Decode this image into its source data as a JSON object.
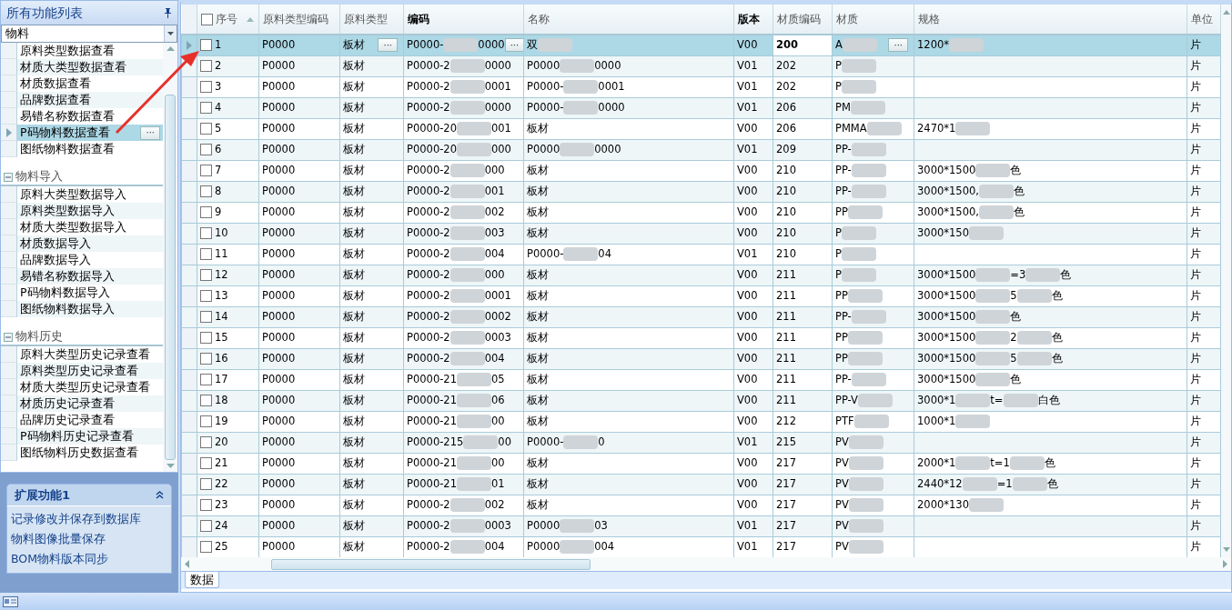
{
  "sidebar": {
    "title": "所有功能列表",
    "filter": {
      "value": "物料"
    },
    "ellipsis": "···",
    "groups": [
      {
        "items": [
          {
            "label": "原料类型数据查看",
            "selected": false
          },
          {
            "label": "材质大类型数据查看",
            "selected": false
          },
          {
            "label": "材质数据查看",
            "selected": false
          },
          {
            "label": "品牌数据查看",
            "selected": false
          },
          {
            "label": "易错名称数据查看",
            "selected": false
          },
          {
            "label": "P码物料数据查看",
            "selected": true
          },
          {
            "label": "图纸物料数据查看",
            "selected": false
          }
        ]
      },
      {
        "label": "物料导入",
        "expanded": true,
        "items": [
          {
            "label": "原料大类型数据导入",
            "selected": false
          },
          {
            "label": "原料类型数据导入",
            "selected": false
          },
          {
            "label": "材质大类型数据导入",
            "selected": false
          },
          {
            "label": "材质数据导入",
            "selected": false
          },
          {
            "label": "品牌数据导入",
            "selected": false
          },
          {
            "label": "易错名称数据导入",
            "selected": false
          },
          {
            "label": "P码物料数据导入",
            "selected": false
          },
          {
            "label": "图纸物料数据导入",
            "selected": false
          }
        ]
      },
      {
        "label": "物料历史",
        "expanded": true,
        "items": [
          {
            "label": "原料大类型历史记录查看",
            "selected": false
          },
          {
            "label": "原料类型历史记录查看",
            "selected": false
          },
          {
            "label": "材质大类型历史记录查看",
            "selected": false
          },
          {
            "label": "材质历史记录查看",
            "selected": false
          },
          {
            "label": "品牌历史记录查看",
            "selected": false
          },
          {
            "label": "P码物料历史记录查看",
            "selected": false
          },
          {
            "label": "图纸物料历史数据查看",
            "selected": false
          }
        ]
      }
    ]
  },
  "extension_panel": {
    "title": "扩展功能1",
    "expanded": true,
    "links": [
      "记录修改并保存到数据库",
      "物料图像批量保存",
      "BOM物料版本同步"
    ]
  },
  "table": {
    "select_all": {
      "checked": false
    },
    "columns": [
      {
        "label": "序号",
        "bold": false,
        "sorted": true
      },
      {
        "label": "原料类型编码",
        "bold": false,
        "sorted": false
      },
      {
        "label": "原料类型",
        "bold": false,
        "sorted": false
      },
      {
        "label": "编码",
        "bold": true,
        "sorted": false
      },
      {
        "label": "名称",
        "bold": false,
        "sorted": false
      },
      {
        "label": "版本",
        "bold": true,
        "sorted": false
      },
      {
        "label": "材质编码",
        "bold": false,
        "sorted": false
      },
      {
        "label": "材质",
        "bold": false,
        "sorted": false
      },
      {
        "label": "规格",
        "bold": false,
        "sorted": false
      },
      {
        "label": "单位",
        "bold": false,
        "sorted": false
      }
    ],
    "rows": [
      {
        "selected": true,
        "checked": false,
        "cells": [
          "1",
          "P0000",
          {
            "text": "板材",
            "button": "···"
          },
          {
            "parts": [
              {
                "kind": "text",
                "text": "P0000-"
              },
              {
                "kind": "blur"
              },
              {
                "kind": "text",
                "text": "0000"
              }
            ],
            "button": "···"
          },
          [
            {
              "kind": "text",
              "text": "双"
            },
            {
              "kind": "blur"
            }
          ],
          "V00",
          "200",
          {
            "parts": [
              {
                "kind": "text",
                "text": "A"
              },
              {
                "kind": "blur"
              }
            ],
            "button": "···"
          },
          [
            {
              "kind": "text",
              "text": "1200*"
            },
            {
              "kind": "blur"
            }
          ],
          "片"
        ]
      },
      {
        "selected": false,
        "checked": false,
        "cells": [
          "2",
          "P0000",
          "板材",
          [
            {
              "kind": "text",
              "text": "P0000-2"
            },
            {
              "kind": "blur"
            },
            {
              "kind": "text",
              "text": "0000"
            }
          ],
          [
            {
              "kind": "text",
              "text": "P0000"
            },
            {
              "kind": "blur"
            },
            {
              "kind": "text",
              "text": "0000"
            }
          ],
          "V01",
          "202",
          [
            {
              "kind": "text",
              "text": "P"
            },
            {
              "kind": "blur"
            }
          ],
          null,
          "片"
        ]
      },
      {
        "selected": false,
        "checked": false,
        "cells": [
          "3",
          "P0000",
          "板材",
          [
            {
              "kind": "text",
              "text": "P0000-2"
            },
            {
              "kind": "blur"
            },
            {
              "kind": "text",
              "text": "0001"
            }
          ],
          [
            {
              "kind": "text",
              "text": "P0000-"
            },
            {
              "kind": "blur"
            },
            {
              "kind": "text",
              "text": "0001"
            }
          ],
          "V01",
          "202",
          [
            {
              "kind": "text",
              "text": "P"
            },
            {
              "kind": "blur"
            }
          ],
          null,
          "片"
        ]
      },
      {
        "selected": false,
        "checked": false,
        "cells": [
          "4",
          "P0000",
          "板材",
          [
            {
              "kind": "text",
              "text": "P0000-2"
            },
            {
              "kind": "blur"
            },
            {
              "kind": "text",
              "text": "0000"
            }
          ],
          [
            {
              "kind": "text",
              "text": "P0000-"
            },
            {
              "kind": "blur"
            },
            {
              "kind": "text",
              "text": "0000"
            }
          ],
          "V01",
          "206",
          [
            {
              "kind": "text",
              "text": "PM"
            },
            {
              "kind": "blur"
            }
          ],
          null,
          "片"
        ]
      },
      {
        "selected": false,
        "checked": false,
        "cells": [
          "5",
          "P0000",
          "板材",
          [
            {
              "kind": "text",
              "text": "P0000-20"
            },
            {
              "kind": "blur"
            },
            {
              "kind": "text",
              "text": "001"
            }
          ],
          "板材",
          "V00",
          "206",
          [
            {
              "kind": "text",
              "text": "PMMA"
            },
            {
              "kind": "blur"
            }
          ],
          [
            {
              "kind": "text",
              "text": "2470*1"
            },
            {
              "kind": "blur"
            }
          ],
          "片"
        ]
      },
      {
        "selected": false,
        "checked": false,
        "cells": [
          "6",
          "P0000",
          "板材",
          [
            {
              "kind": "text",
              "text": "P0000-20"
            },
            {
              "kind": "blur"
            },
            {
              "kind": "text",
              "text": "000"
            }
          ],
          [
            {
              "kind": "text",
              "text": "P0000"
            },
            {
              "kind": "blur"
            },
            {
              "kind": "text",
              "text": "0000"
            }
          ],
          "V01",
          "209",
          [
            {
              "kind": "text",
              "text": "PP-"
            },
            {
              "kind": "blur"
            }
          ],
          null,
          "片"
        ]
      },
      {
        "selected": false,
        "checked": false,
        "cells": [
          "7",
          "P0000",
          "板材",
          [
            {
              "kind": "text",
              "text": "P0000-2"
            },
            {
              "kind": "blur"
            },
            {
              "kind": "text",
              "text": "000"
            }
          ],
          "板材",
          "V00",
          "210",
          [
            {
              "kind": "text",
              "text": "PP-"
            },
            {
              "kind": "blur"
            }
          ],
          [
            {
              "kind": "text",
              "text": "3000*1500"
            },
            {
              "kind": "blur"
            },
            {
              "kind": "text",
              "text": "色"
            }
          ],
          "片"
        ]
      },
      {
        "selected": false,
        "checked": false,
        "cells": [
          "8",
          "P0000",
          "板材",
          [
            {
              "kind": "text",
              "text": "P0000-2"
            },
            {
              "kind": "blur"
            },
            {
              "kind": "text",
              "text": "001"
            }
          ],
          "板材",
          "V00",
          "210",
          [
            {
              "kind": "text",
              "text": "PP-"
            },
            {
              "kind": "blur"
            }
          ],
          [
            {
              "kind": "text",
              "text": "3000*1500,"
            },
            {
              "kind": "blur"
            },
            {
              "kind": "text",
              "text": "色"
            }
          ],
          "片"
        ]
      },
      {
        "selected": false,
        "checked": false,
        "cells": [
          "9",
          "P0000",
          "板材",
          [
            {
              "kind": "text",
              "text": "P0000-2"
            },
            {
              "kind": "blur"
            },
            {
              "kind": "text",
              "text": "002"
            }
          ],
          "板材",
          "V00",
          "210",
          [
            {
              "kind": "text",
              "text": "PP"
            },
            {
              "kind": "blur"
            }
          ],
          [
            {
              "kind": "text",
              "text": "3000*1500,"
            },
            {
              "kind": "blur"
            },
            {
              "kind": "text",
              "text": "色"
            }
          ],
          "片"
        ]
      },
      {
        "selected": false,
        "checked": false,
        "cells": [
          "10",
          "P0000",
          "板材",
          [
            {
              "kind": "text",
              "text": "P0000-2"
            },
            {
              "kind": "blur"
            },
            {
              "kind": "text",
              "text": "003"
            }
          ],
          "板材",
          "V00",
          "210",
          [
            {
              "kind": "text",
              "text": "P"
            },
            {
              "kind": "blur"
            }
          ],
          [
            {
              "kind": "text",
              "text": "3000*150"
            },
            {
              "kind": "blur"
            }
          ],
          "片"
        ]
      },
      {
        "selected": false,
        "checked": false,
        "cells": [
          "11",
          "P0000",
          "板材",
          [
            {
              "kind": "text",
              "text": "P0000-2"
            },
            {
              "kind": "blur"
            },
            {
              "kind": "text",
              "text": "004"
            }
          ],
          [
            {
              "kind": "text",
              "text": "P0000-"
            },
            {
              "kind": "blur"
            },
            {
              "kind": "text",
              "text": "04"
            }
          ],
          "V01",
          "210",
          [
            {
              "kind": "text",
              "text": "P"
            },
            {
              "kind": "blur"
            }
          ],
          null,
          "片"
        ]
      },
      {
        "selected": false,
        "checked": false,
        "cells": [
          "12",
          "P0000",
          "板材",
          [
            {
              "kind": "text",
              "text": "P0000-2"
            },
            {
              "kind": "blur"
            },
            {
              "kind": "text",
              "text": "000"
            }
          ],
          "板材",
          "V00",
          "211",
          [
            {
              "kind": "text",
              "text": "P"
            },
            {
              "kind": "blur"
            }
          ],
          [
            {
              "kind": "text",
              "text": "3000*1500"
            },
            {
              "kind": "blur"
            },
            {
              "kind": "text",
              "text": "=3"
            },
            {
              "kind": "blur"
            },
            {
              "kind": "text",
              "text": "色"
            }
          ],
          "片"
        ]
      },
      {
        "selected": false,
        "checked": false,
        "cells": [
          "13",
          "P0000",
          "板材",
          [
            {
              "kind": "text",
              "text": "P0000-2"
            },
            {
              "kind": "blur"
            },
            {
              "kind": "text",
              "text": "0001"
            }
          ],
          "板材",
          "V00",
          "211",
          [
            {
              "kind": "text",
              "text": "PP"
            },
            {
              "kind": "blur"
            }
          ],
          [
            {
              "kind": "text",
              "text": "3000*1500"
            },
            {
              "kind": "blur"
            },
            {
              "kind": "text",
              "text": "5"
            },
            {
              "kind": "blur"
            },
            {
              "kind": "text",
              "text": "色"
            }
          ],
          "片"
        ]
      },
      {
        "selected": false,
        "checked": false,
        "cells": [
          "14",
          "P0000",
          "板材",
          [
            {
              "kind": "text",
              "text": "P0000-2"
            },
            {
              "kind": "blur"
            },
            {
              "kind": "text",
              "text": "0002"
            }
          ],
          "板材",
          "V00",
          "211",
          [
            {
              "kind": "text",
              "text": "PP-"
            },
            {
              "kind": "blur"
            }
          ],
          [
            {
              "kind": "text",
              "text": "3000*1500"
            },
            {
              "kind": "blur"
            },
            {
              "kind": "text",
              "text": "色"
            }
          ],
          "片"
        ]
      },
      {
        "selected": false,
        "checked": false,
        "cells": [
          "15",
          "P0000",
          "板材",
          [
            {
              "kind": "text",
              "text": "P0000-2"
            },
            {
              "kind": "blur"
            },
            {
              "kind": "text",
              "text": "0003"
            }
          ],
          "板材",
          "V00",
          "211",
          [
            {
              "kind": "text",
              "text": "PP"
            },
            {
              "kind": "blur"
            }
          ],
          [
            {
              "kind": "text",
              "text": "3000*1500"
            },
            {
              "kind": "blur"
            },
            {
              "kind": "text",
              "text": "2"
            },
            {
              "kind": "blur"
            },
            {
              "kind": "text",
              "text": "色"
            }
          ],
          "片"
        ]
      },
      {
        "selected": false,
        "checked": false,
        "cells": [
          "16",
          "P0000",
          "板材",
          [
            {
              "kind": "text",
              "text": "P0000-2"
            },
            {
              "kind": "blur"
            },
            {
              "kind": "text",
              "text": "004"
            }
          ],
          "板材",
          "V00",
          "211",
          [
            {
              "kind": "text",
              "text": "PP"
            },
            {
              "kind": "blur"
            }
          ],
          [
            {
              "kind": "text",
              "text": "3000*1500"
            },
            {
              "kind": "blur"
            },
            {
              "kind": "text",
              "text": "5"
            },
            {
              "kind": "blur"
            },
            {
              "kind": "text",
              "text": "色"
            }
          ],
          "片"
        ]
      },
      {
        "selected": false,
        "checked": false,
        "cells": [
          "17",
          "P0000",
          "板材",
          [
            {
              "kind": "text",
              "text": "P0000-21"
            },
            {
              "kind": "blur"
            },
            {
              "kind": "text",
              "text": "05"
            }
          ],
          "板材",
          "V00",
          "211",
          [
            {
              "kind": "text",
              "text": "PP-"
            },
            {
              "kind": "blur"
            }
          ],
          [
            {
              "kind": "text",
              "text": "3000*1500"
            },
            {
              "kind": "blur"
            },
            {
              "kind": "text",
              "text": "色"
            }
          ],
          "片"
        ]
      },
      {
        "selected": false,
        "checked": false,
        "cells": [
          "18",
          "P0000",
          "板材",
          [
            {
              "kind": "text",
              "text": "P0000-21"
            },
            {
              "kind": "blur"
            },
            {
              "kind": "text",
              "text": "06"
            }
          ],
          "板材",
          "V00",
          "211",
          [
            {
              "kind": "text",
              "text": "PP-V"
            },
            {
              "kind": "blur"
            }
          ],
          [
            {
              "kind": "text",
              "text": "3000*1"
            },
            {
              "kind": "blur"
            },
            {
              "kind": "text",
              "text": "t="
            },
            {
              "kind": "blur"
            },
            {
              "kind": "text",
              "text": "白色"
            }
          ],
          "片"
        ]
      },
      {
        "selected": false,
        "checked": false,
        "cells": [
          "19",
          "P0000",
          "板材",
          [
            {
              "kind": "text",
              "text": "P0000-21"
            },
            {
              "kind": "blur"
            },
            {
              "kind": "text",
              "text": "00"
            }
          ],
          "板材",
          "V00",
          "212",
          [
            {
              "kind": "text",
              "text": "PTF"
            },
            {
              "kind": "blur"
            }
          ],
          [
            {
              "kind": "text",
              "text": "1000*1"
            },
            {
              "kind": "blur"
            }
          ],
          "片"
        ]
      },
      {
        "selected": false,
        "checked": false,
        "cells": [
          "20",
          "P0000",
          "板材",
          [
            {
              "kind": "text",
              "text": "P0000-215"
            },
            {
              "kind": "blur"
            },
            {
              "kind": "text",
              "text": "00"
            }
          ],
          [
            {
              "kind": "text",
              "text": "P0000-"
            },
            {
              "kind": "blur"
            },
            {
              "kind": "text",
              "text": "0"
            }
          ],
          "V01",
          "215",
          [
            {
              "kind": "text",
              "text": "PV"
            },
            {
              "kind": "blur"
            }
          ],
          null,
          "片"
        ]
      },
      {
        "selected": false,
        "checked": false,
        "cells": [
          "21",
          "P0000",
          "板材",
          [
            {
              "kind": "text",
              "text": "P0000-21"
            },
            {
              "kind": "blur"
            },
            {
              "kind": "text",
              "text": "00"
            }
          ],
          "板材",
          "V00",
          "217",
          [
            {
              "kind": "text",
              "text": "PV"
            },
            {
              "kind": "blur"
            }
          ],
          [
            {
              "kind": "text",
              "text": "2000*1"
            },
            {
              "kind": "blur"
            },
            {
              "kind": "text",
              "text": "t=1"
            },
            {
              "kind": "blur"
            },
            {
              "kind": "text",
              "text": "色"
            }
          ],
          "片"
        ]
      },
      {
        "selected": false,
        "checked": false,
        "cells": [
          "22",
          "P0000",
          "板材",
          [
            {
              "kind": "text",
              "text": "P0000-21"
            },
            {
              "kind": "blur"
            },
            {
              "kind": "text",
              "text": "01"
            }
          ],
          "板材",
          "V00",
          "217",
          [
            {
              "kind": "text",
              "text": "PV"
            },
            {
              "kind": "blur"
            }
          ],
          [
            {
              "kind": "text",
              "text": "2440*12"
            },
            {
              "kind": "blur"
            },
            {
              "kind": "text",
              "text": "=1"
            },
            {
              "kind": "blur"
            },
            {
              "kind": "text",
              "text": "色"
            }
          ],
          "片"
        ]
      },
      {
        "selected": false,
        "checked": false,
        "cells": [
          "23",
          "P0000",
          "板材",
          [
            {
              "kind": "text",
              "text": "P0000-2"
            },
            {
              "kind": "blur"
            },
            {
              "kind": "text",
              "text": "002"
            }
          ],
          "板材",
          "V00",
          "217",
          [
            {
              "kind": "text",
              "text": "PV"
            },
            {
              "kind": "blur"
            }
          ],
          [
            {
              "kind": "text",
              "text": "2000*130"
            },
            {
              "kind": "blur"
            }
          ],
          "片"
        ]
      },
      {
        "selected": false,
        "checked": false,
        "cells": [
          "24",
          "P0000",
          "板材",
          [
            {
              "kind": "text",
              "text": "P0000-2"
            },
            {
              "kind": "blur"
            },
            {
              "kind": "text",
              "text": "0003"
            }
          ],
          [
            {
              "kind": "text",
              "text": "P0000"
            },
            {
              "kind": "blur"
            },
            {
              "kind": "text",
              "text": "03"
            }
          ],
          "V01",
          "217",
          [
            {
              "kind": "text",
              "text": "PV"
            },
            {
              "kind": "blur"
            }
          ],
          null,
          "片"
        ]
      },
      {
        "selected": false,
        "checked": false,
        "cells": [
          "25",
          "P0000",
          "板材",
          [
            {
              "kind": "text",
              "text": "P0000-2"
            },
            {
              "kind": "blur"
            },
            {
              "kind": "text",
              "text": "004"
            }
          ],
          [
            {
              "kind": "text",
              "text": "P0000"
            },
            {
              "kind": "blur"
            },
            {
              "kind": "text",
              "text": "004"
            }
          ],
          "V01",
          "217",
          [
            {
              "kind": "text",
              "text": "PV"
            },
            {
              "kind": "blur"
            }
          ],
          null,
          "片"
        ]
      }
    ]
  },
  "tabs": [
    {
      "label": "数据",
      "selected": true
    }
  ]
}
